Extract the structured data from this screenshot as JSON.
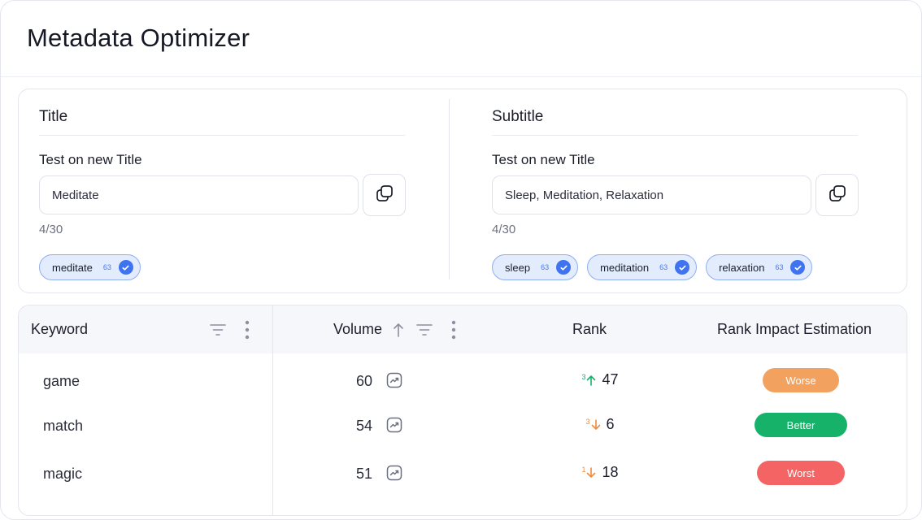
{
  "app": {
    "title": "Metadata Optimizer"
  },
  "title_section": {
    "heading": "Title",
    "field_label": "Test on new Title",
    "input_value": "Meditate",
    "counter": "4/30",
    "chips": [
      {
        "label": "meditate",
        "count": "63"
      }
    ]
  },
  "subtitle_section": {
    "heading": "Subtitle",
    "field_label": "Test on new Title",
    "input_value": "Sleep, Meditation, Relaxation",
    "counter": "4/30",
    "chips": [
      {
        "label": "sleep",
        "count": "63"
      },
      {
        "label": "meditation",
        "count": "63"
      },
      {
        "label": "relaxation",
        "count": "63"
      }
    ]
  },
  "table": {
    "headers": {
      "keyword": "Keyword",
      "volume": "Volume",
      "rank": "Rank",
      "impact": "Rank Impact Estimation"
    },
    "rows": [
      {
        "keyword": "game",
        "volume": "60",
        "rank_delta": "3",
        "rank_direction": "up",
        "rank": "47",
        "impact": "Worse",
        "impact_color": "#f2a15f"
      },
      {
        "keyword": "match",
        "volume": "54",
        "rank_delta": "3",
        "rank_direction": "down",
        "rank": "6",
        "impact": "Better",
        "impact_color": "#17b26a"
      },
      {
        "keyword": "magic",
        "volume": "51",
        "rank_delta": "1",
        "rank_direction": "down",
        "rank": "18",
        "impact": "Worst",
        "impact_color": "#f46464"
      }
    ]
  },
  "colors": {
    "accent_blue": "#3f73f0",
    "chip_bg": "#e3ecfd",
    "rank_up": "#17b26a",
    "rank_down": "#f08a3c"
  },
  "icons": {
    "copy": "copy-icon",
    "check": "check-circle-icon",
    "filter": "filter-icon",
    "more": "more-vertical-icon",
    "sort": "sort-ascending-icon",
    "trend": "trend-chart-icon"
  }
}
